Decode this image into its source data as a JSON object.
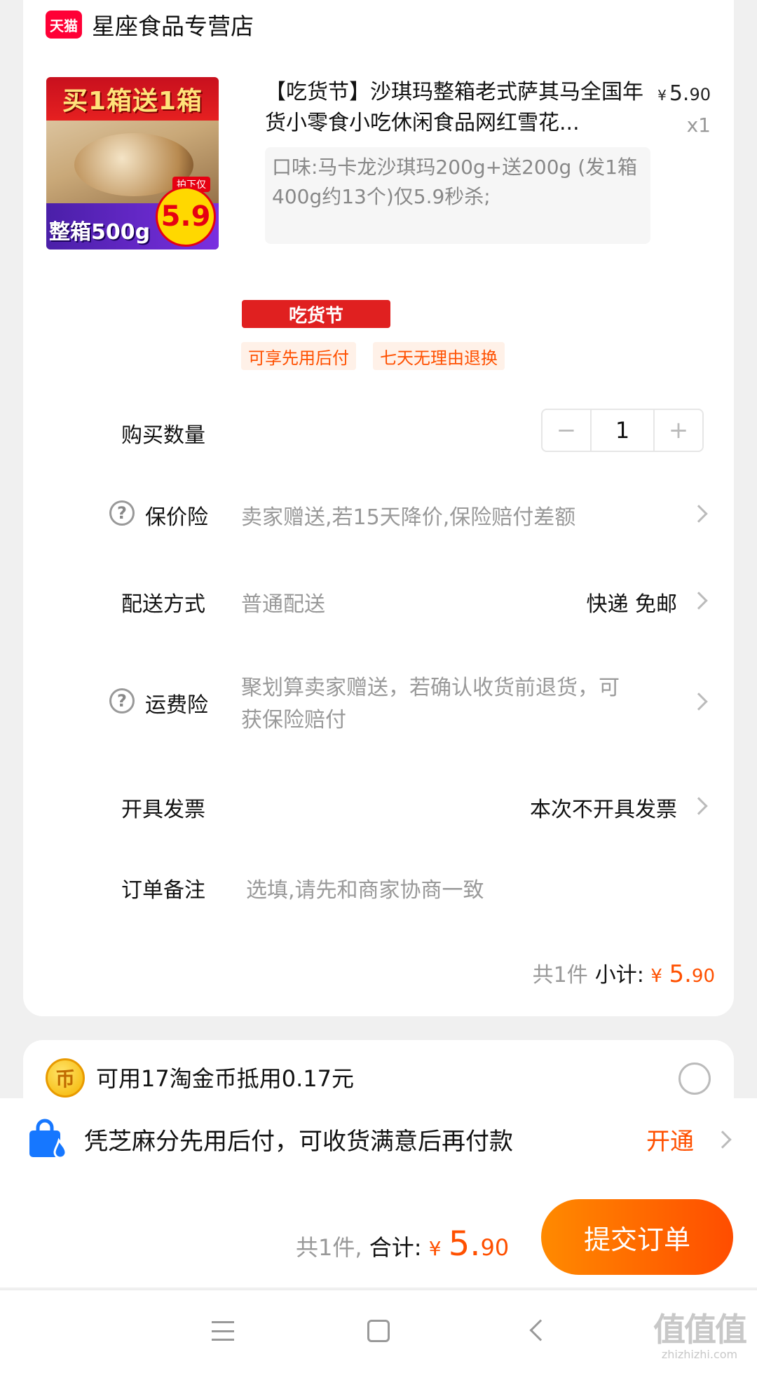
{
  "store": {
    "badge": "天猫",
    "name": "星座食品专营店"
  },
  "product": {
    "image_top_text": "买1箱送1箱",
    "image_bottom_text": "整箱500g",
    "image_price": "5.9",
    "image_tag": "拍下仅",
    "title": "【吃货节】沙琪玛整箱老式萨其马全国年货小零食小吃休闲食品网红雪花...",
    "price_yen": "¥",
    "price_int": "5.",
    "price_dec": "90",
    "qty": "x1",
    "sku": "口味:马卡龙沙琪玛200g+送200g (发1箱400g约13个)仅5.9秒杀;"
  },
  "promo": {
    "banner": "吃货节",
    "tags": [
      "可享先用后付",
      "七天无理由退换"
    ]
  },
  "rows": {
    "quantity": {
      "label": "购买数量",
      "value": "1",
      "minus": "−",
      "plus": "+"
    },
    "price_protect": {
      "label": "保价险",
      "value": "卖家赠送,若15天降价,保险赔付差额"
    },
    "delivery": {
      "label": "配送方式",
      "value": "普通配送",
      "right": "快递 免邮"
    },
    "freight_insurance": {
      "label": "运费险",
      "value_line1": "聚划算卖家赠送，若确认收货前退货，可",
      "value_line2": "获保险赔付"
    },
    "invoice": {
      "label": "开具发票",
      "right": "本次不开具发票"
    },
    "note": {
      "label": "订单备注",
      "placeholder": "选填,请先和商家协商一致"
    }
  },
  "subtotal": {
    "count": "共1件",
    "label": "小计:",
    "yen": "¥",
    "price_int": "5.",
    "price_dec": "90"
  },
  "coins": {
    "icon_text": "币",
    "text": "可用17淘金币抵用0.17元"
  },
  "pay_later": {
    "text": "凭芝麻分先用后付，可收货满意后再付款",
    "action": "开通"
  },
  "footer": {
    "count": "共1件,",
    "total_label": "合计:",
    "yen": "¥",
    "price_int": "5.",
    "price_dec": "90",
    "submit": "提交订单"
  },
  "watermark": {
    "main": "值值值",
    "sub": "zhizhizhi.com"
  },
  "colors": {
    "accent": "#ff5000",
    "tmall_red": "#ff0036"
  }
}
